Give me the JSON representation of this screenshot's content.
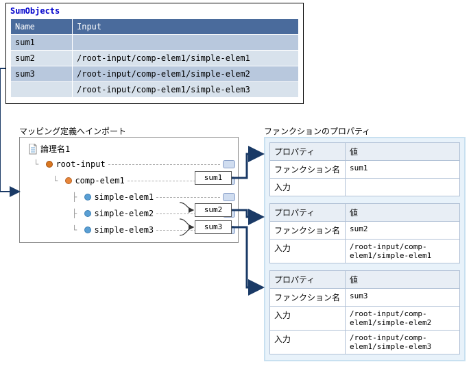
{
  "sumObjects": {
    "title": "SumObjects",
    "headers": {
      "name": "Name",
      "input": "Input"
    },
    "rows": [
      {
        "name": "sum1",
        "input": ""
      },
      {
        "name": "sum2",
        "input": "/root-input/comp-elem1/simple-elem1"
      },
      {
        "name": "sum3",
        "input": "/root-input/comp-elem1/simple-elem2"
      },
      {
        "name": "",
        "input": "/root-input/comp-elem1/simple-elem3"
      }
    ]
  },
  "mapping": {
    "label": "マッピング定義へインポート",
    "logicalName": "論理名1",
    "tree": {
      "root": "root-input",
      "comp": "comp-elem1",
      "s1": "simple-elem1",
      "s2": "simple-elem2",
      "s3": "simple-elem3"
    }
  },
  "fn": {
    "sum1": "sum1",
    "sum2": "sum2",
    "sum3": "sum3"
  },
  "props": {
    "label": "ファンクションのプロパティ",
    "header": {
      "prop": "プロパティ",
      "val": "値"
    },
    "keys": {
      "fnName": "ファンクション名",
      "input": "入力"
    },
    "tables": [
      {
        "fnName": "sum1",
        "inputs": [
          ""
        ]
      },
      {
        "fnName": "sum2",
        "inputs": [
          "/root-input/comp-elem1/simple-elem1"
        ]
      },
      {
        "fnName": "sum3",
        "inputs": [
          "/root-input/comp-elem1/simple-elem2",
          "/root-input/comp-elem1/simple-elem3"
        ]
      }
    ]
  }
}
